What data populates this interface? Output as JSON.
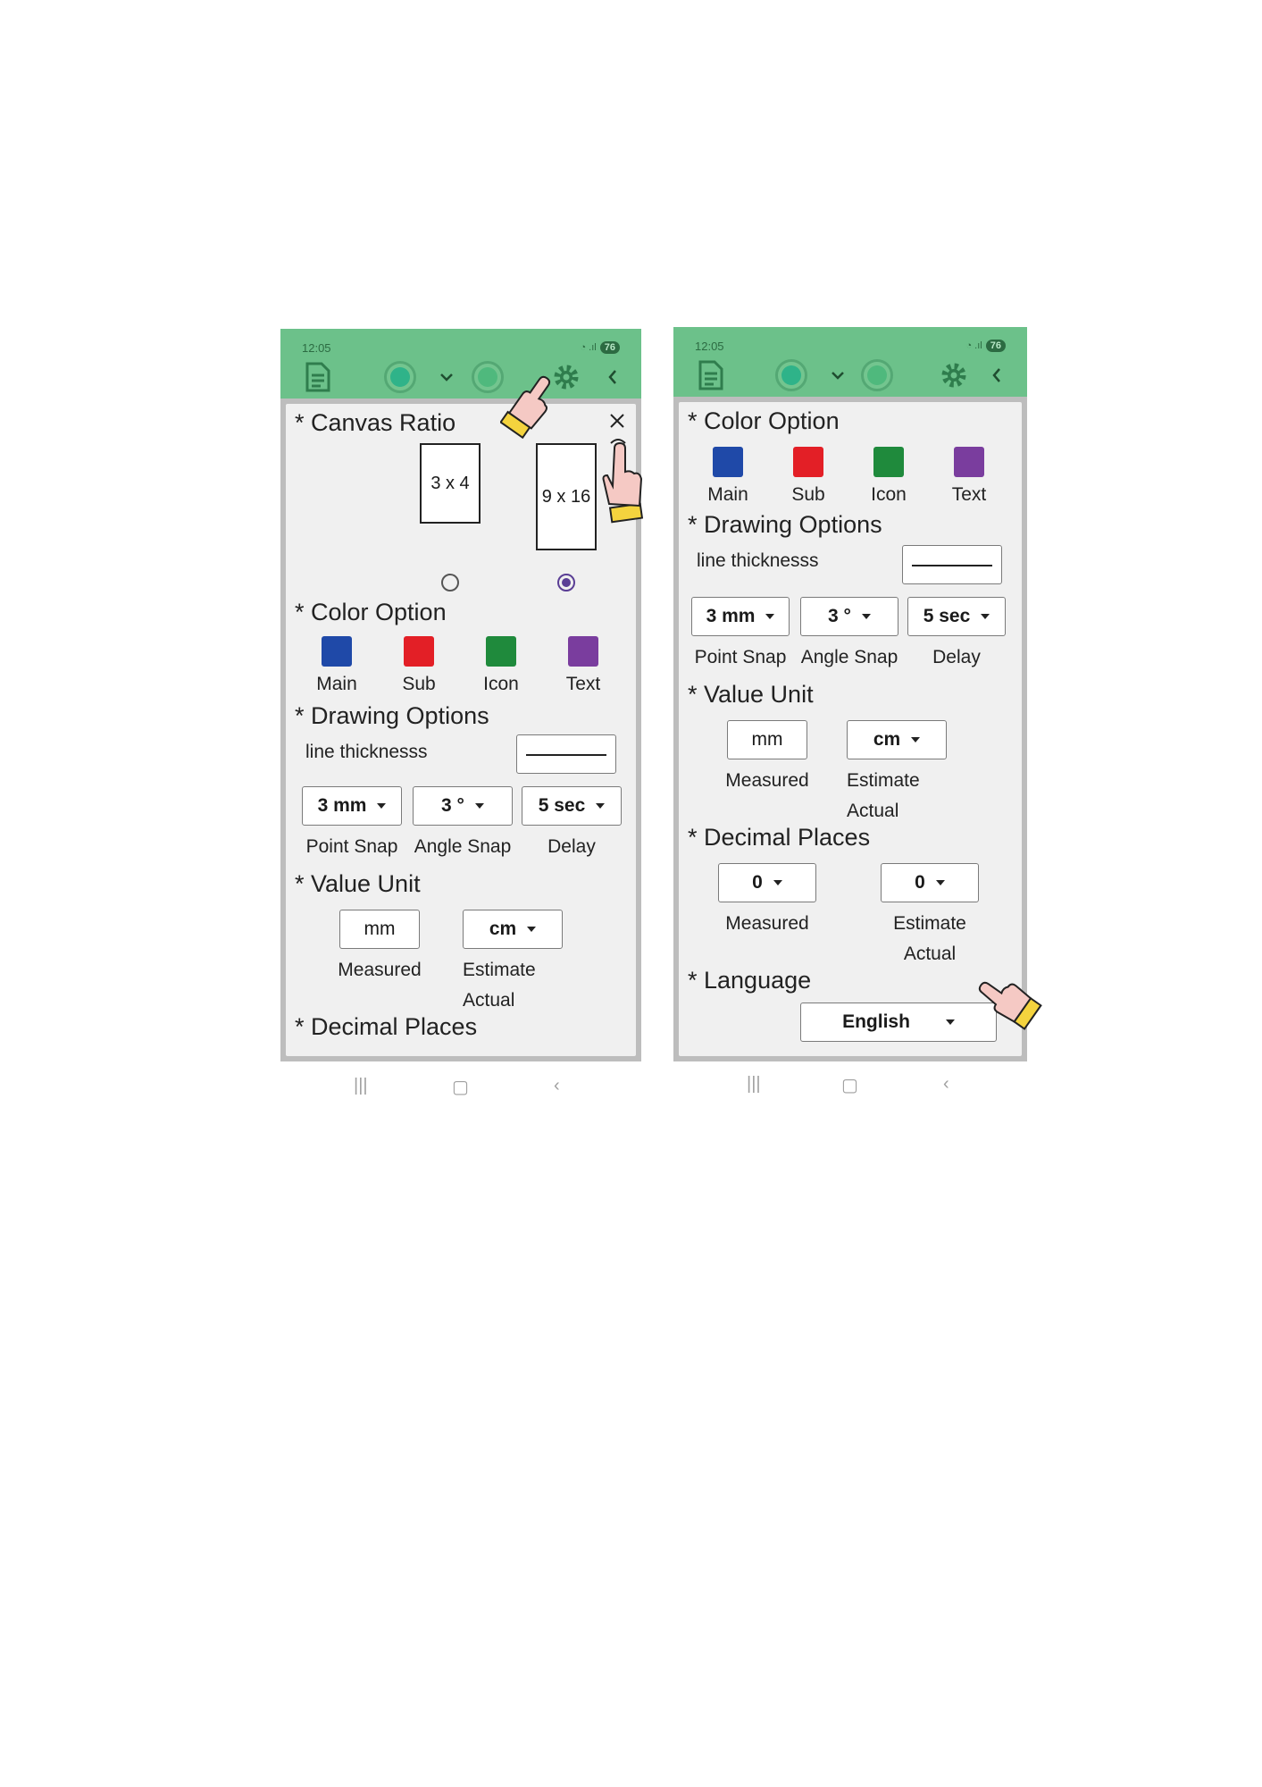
{
  "colors": {
    "topbar": "#6cc18a",
    "main": "#1f49a8",
    "sub": "#e31f26",
    "icon": "#1f8a3c",
    "text": "#7a3d9e"
  },
  "status": {
    "time": "12:05",
    "battery": "76"
  },
  "left": {
    "canvas_ratio": {
      "title": "* Canvas Ratio",
      "option_a": "3 x 4",
      "option_b": "9 x 16",
      "selected": "9 x 16"
    },
    "color_option": {
      "title": "* Color Option",
      "labels": [
        "Main",
        "Sub",
        "Icon",
        "Text"
      ]
    },
    "drawing_options": {
      "title": "* Drawing Options",
      "line_label": "line thicknesss",
      "point_snap": {
        "value": "3 mm",
        "label": "Point Snap"
      },
      "angle_snap": {
        "value": "3 °",
        "label": "Angle Snap"
      },
      "delay": {
        "value": "5 sec",
        "label": "Delay"
      }
    },
    "value_unit": {
      "title": "* Value Unit",
      "measured_value": "mm",
      "measured_label": "Measured",
      "estimate_value": "cm",
      "estimate_label_1": "Estimate",
      "estimate_label_2": "Actual"
    },
    "decimal_places": {
      "title": "* Decimal Places"
    }
  },
  "right": {
    "color_option": {
      "title": "* Color Option",
      "labels": [
        "Main",
        "Sub",
        "Icon",
        "Text"
      ]
    },
    "drawing_options": {
      "title": "* Drawing Options",
      "line_label": "line thicknesss",
      "point_snap": {
        "value": "3 mm",
        "label": "Point Snap"
      },
      "angle_snap": {
        "value": "3 °",
        "label": "Angle Snap"
      },
      "delay": {
        "value": "5 sec",
        "label": "Delay"
      }
    },
    "value_unit": {
      "title": "* Value Unit",
      "measured_value": "mm",
      "measured_label": "Measured",
      "estimate_value": "cm",
      "estimate_label_1": "Estimate",
      "estimate_label_2": "Actual"
    },
    "decimal_places": {
      "title": "* Decimal Places",
      "measured_value": "0",
      "measured_label": "Measured",
      "estimate_value": "0",
      "estimate_label_1": "Estimate",
      "estimate_label_2": "Actual"
    },
    "language": {
      "title": "* Language",
      "value": "English"
    }
  },
  "icons": {
    "doc": "document-icon",
    "record": "record-icon",
    "chevron": "chevron-down-icon",
    "settings": "gear-icon",
    "back": "back-icon",
    "close": "close-icon",
    "pointer": "pointing-hand-icon"
  }
}
